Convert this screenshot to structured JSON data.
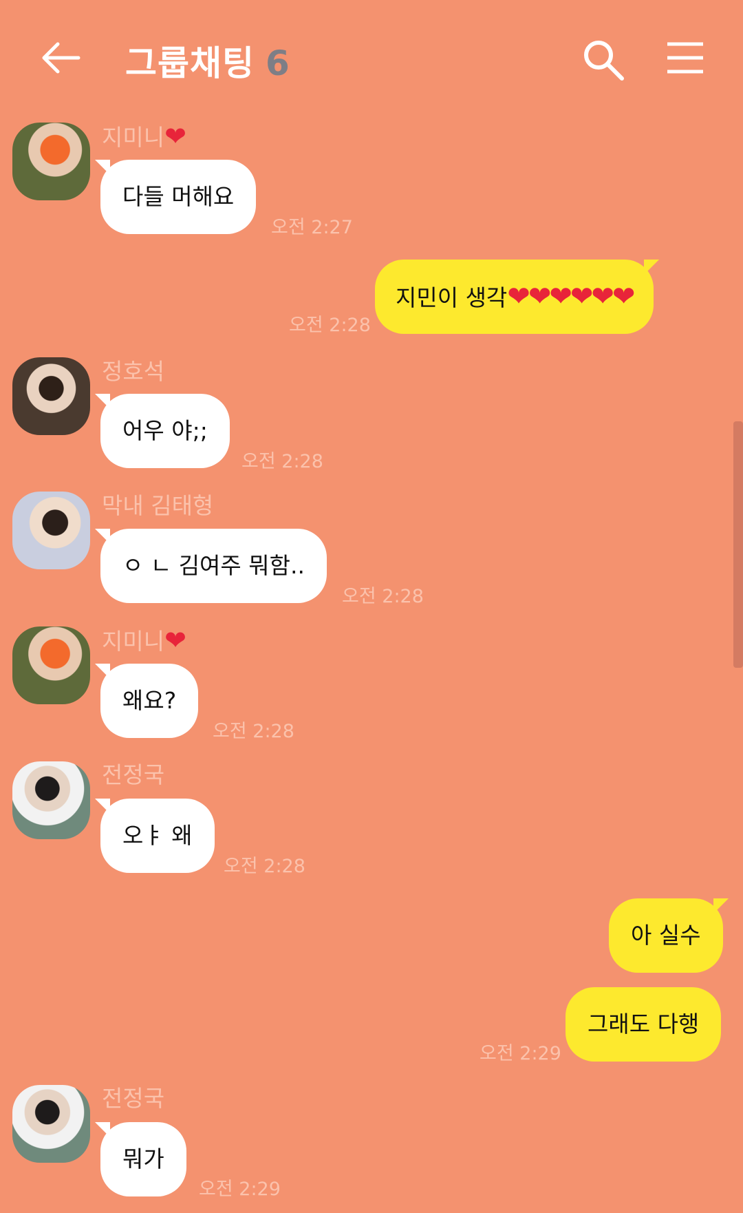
{
  "header": {
    "back_icon": "back-arrow-icon",
    "title": "그룹채팅",
    "member_count": "6",
    "search_icon": "search-icon",
    "menu_icon": "hamburger-menu-icon"
  },
  "colors": {
    "background": "#F4926F",
    "my_bubble": "#FDE92E",
    "other_bubble": "#FFFFFF",
    "name_time": "#FBC2AC",
    "heart": "#E8243A",
    "member_count": "#7E7E86"
  },
  "messages": [
    {
      "sender": "지미니",
      "sender_suffix": "❤",
      "text": "다들 머해요",
      "time": "오전 2:27"
    },
    {
      "sender": "me",
      "text": "지민이 생각",
      "hearts": "❤❤❤❤❤❤",
      "time": "오전 2:28"
    },
    {
      "sender": "정호석",
      "text": "어우 야;;",
      "time": "오전 2:28"
    },
    {
      "sender": "막내 김태형",
      "text": "ㅇ ㄴ 김여주 뭐함..",
      "time": "오전 2:28"
    },
    {
      "sender": "지미니",
      "sender_suffix": "❤",
      "text": "왜요?",
      "time": "오전 2:28"
    },
    {
      "sender": "전정국",
      "text": "오ㅑ 왜",
      "time": "오전 2:28"
    },
    {
      "sender": "me",
      "text": "아 실수"
    },
    {
      "sender": "me",
      "text": "그래도 다행",
      "time": "오전 2:29"
    },
    {
      "sender": "전정국",
      "text": "뭐가",
      "time": "오전 2:29"
    }
  ]
}
